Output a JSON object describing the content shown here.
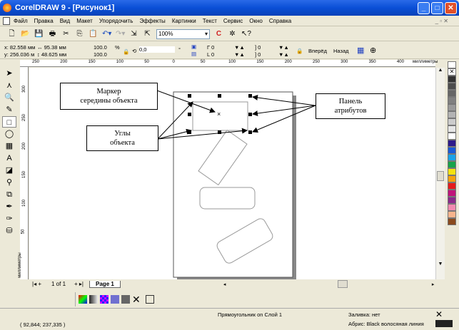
{
  "window": {
    "title": "CorelDRAW 9 - [Рисунок1]"
  },
  "menu": [
    "Файл",
    "Правка",
    "Вид",
    "Макет",
    "Упорядочить",
    "Эффекты",
    "Картинки",
    "Текст",
    "Сервис",
    "Окно",
    "Справка"
  ],
  "toolbar": {
    "zoom": "100%"
  },
  "propbar": {
    "x": "x: 82.558 мм",
    "y": "y: 256.036 м",
    "w": "95.38 мм",
    "h": "48.625 мм",
    "sx": "100.0",
    "sy": "100.0",
    "pct": "%",
    "angle": "0,0",
    "deg": "°",
    "c1": "0",
    "c2": "0",
    "c3": "0",
    "c4": "0",
    "forward": "Вперёд",
    "back": "Назад"
  },
  "ruler": {
    "h_labels": [
      "250",
      "200",
      "150",
      "100",
      "50",
      "0",
      "50",
      "100",
      "150",
      "200",
      "250",
      "300",
      "350",
      "400"
    ],
    "v_labels": [
      "300",
      "250",
      "200",
      "150",
      "100",
      "50"
    ],
    "unit": "миллиметры"
  },
  "callouts": {
    "marker": [
      "Маркер",
      "середины объекта"
    ],
    "panel": [
      "Панель",
      "атрибутов"
    ],
    "corners": [
      "Углы",
      "объекта"
    ]
  },
  "pagebar": {
    "count": "1 of 1",
    "tab": "Page 1"
  },
  "status": {
    "coords": "( 92,844; 237,335 )",
    "object": "Прямоугольник on Слой 1",
    "fill": "Заливка: нет",
    "outline": "Абрис: Black  волосяная линия"
  },
  "palette": [
    "#ffffff",
    "#000000",
    "#333333",
    "#4d4d4d",
    "#666666",
    "#808080",
    "#999999",
    "#b3b3b3",
    "#cccccc",
    "#e6e6e6",
    "#ffffff",
    "#2e1a8a",
    "#1b5ad6",
    "#1aa3e8",
    "#17a34a",
    "#f5e30f",
    "#f4a20e",
    "#e51b1b",
    "#c0157a",
    "#8a2a8a",
    "#f28ab0",
    "#f7b48c",
    "#8a4a1e"
  ],
  "colors": {
    "title": "#0a4fd6",
    "bg": "#ece9d8"
  }
}
